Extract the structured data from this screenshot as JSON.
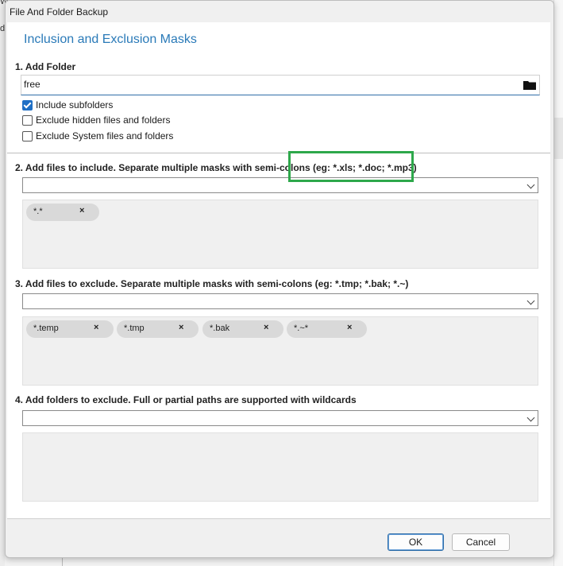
{
  "background": {
    "fragment_top": "W",
    "fragment_mid": "d"
  },
  "window": {
    "title": "File And Folder Backup"
  },
  "heading": "Inclusion and Exclusion Masks",
  "add_folder": {
    "label": "1. Add Folder",
    "value": "free",
    "icon": "folder-icon",
    "options": [
      {
        "label": "Include subfolders",
        "checked": true
      },
      {
        "label": "Exclude hidden files and folders",
        "checked": false
      },
      {
        "label": "Exclude System files and folders",
        "checked": false
      }
    ]
  },
  "include_files": {
    "label": "2. Add files to include. Separate multiple masks with semi-colons (eg: *.xls; *.doc; *.mp3)",
    "value": "",
    "tags": [
      "*.*"
    ]
  },
  "exclude_files": {
    "label": "3. Add files to exclude. Separate multiple masks with semi-colons (eg: *.tmp; *.bak; *.~)",
    "value": "",
    "tags": [
      "*.temp",
      "*.tmp",
      "*.bak",
      "*.~*"
    ]
  },
  "exclude_folders": {
    "label": "4. Add folders to exclude. Full or partial paths are supported with wildcards",
    "value": "",
    "tags": []
  },
  "tag_remove_glyph": "×",
  "buttons": {
    "ok": "OK",
    "cancel": "Cancel"
  },
  "colors": {
    "heading": "#2a7ab8",
    "highlight": "#2ea84b",
    "checkbox": "#1f6fc5"
  }
}
